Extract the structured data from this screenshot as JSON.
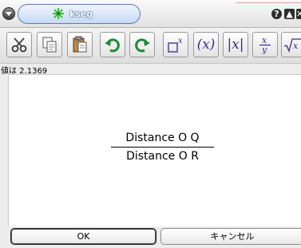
{
  "window": {
    "title": "kseg",
    "help_label": "?",
    "maximize_label": "▲",
    "close_label": "✕"
  },
  "toolbar": {
    "buttons": [
      {
        "icon": "scissors-icon"
      },
      {
        "icon": "copy-icon"
      },
      {
        "icon": "paste-icon"
      },
      {
        "icon": "undo-icon"
      },
      {
        "icon": "redo-icon"
      },
      {
        "icon": "superscript-icon"
      },
      {
        "icon": "parentheses-icon"
      },
      {
        "icon": "absolute-value-icon"
      },
      {
        "icon": "fraction-icon"
      },
      {
        "icon": "square-root-icon"
      }
    ]
  },
  "value_label": "値は 2.1369",
  "expression": {
    "numerator": "Distance O Q",
    "denominator": "Distance O R"
  },
  "buttons": {
    "ok": "OK",
    "cancel": "キャンセル"
  }
}
